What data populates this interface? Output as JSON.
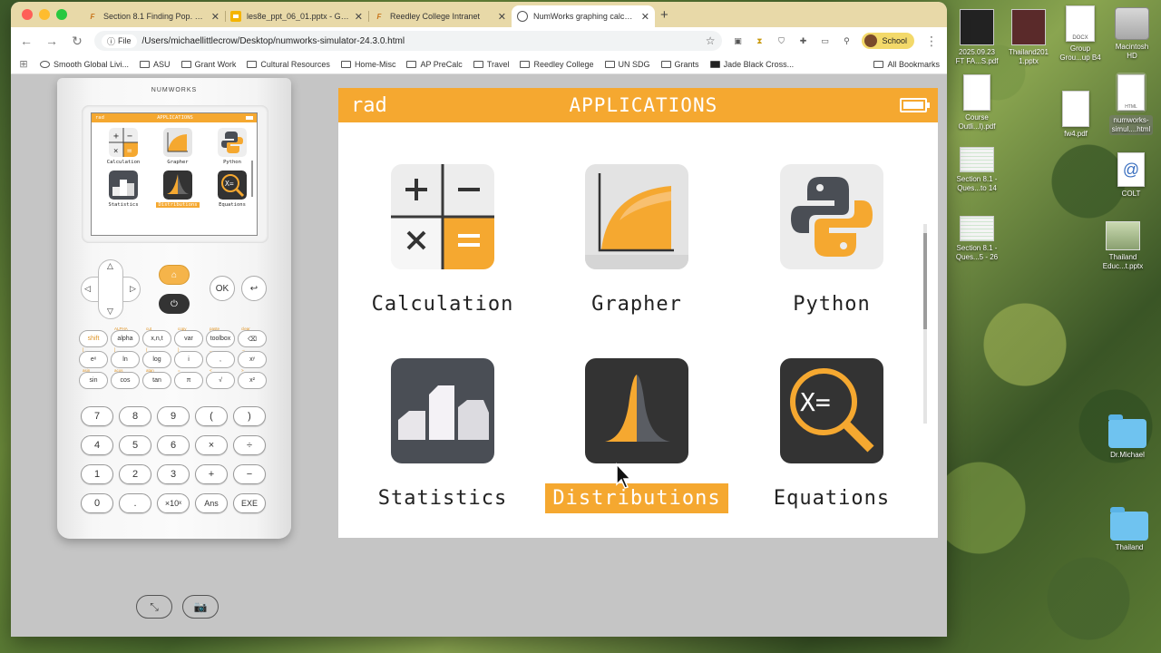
{
  "browser": {
    "tabs": [
      {
        "title": "Section 8.1 Finding Pop. Mean",
        "icon": "document-f-icon",
        "active": false
      },
      {
        "title": "les8e_ppt_06_01.pptx - Goo",
        "icon": "slides-icon",
        "active": false
      },
      {
        "title": "Reedley College Intranet",
        "icon": "document-f-icon",
        "active": false
      },
      {
        "title": "NumWorks graphing calculat",
        "icon": "numworks-icon",
        "active": true
      }
    ],
    "new_tab": "+",
    "address": {
      "chip": "File",
      "url": "/Users/michaellittlecrow/Desktop/numworks-simulator-24.3.0.html"
    },
    "profile": "School",
    "bookmarks": [
      "Smooth Global Livi...",
      "ASU",
      "Grant Work",
      "Cultural Resources",
      "Home-Misc",
      "AP PreCalc",
      "Travel",
      "Reedley College",
      "UN SDG",
      "Grants",
      "Jade Black Cross..."
    ],
    "all_bookmarks": "All Bookmarks"
  },
  "calculator": {
    "brand": "NUMWORKS",
    "mini_screen": {
      "mode": "rad",
      "title": "APPLICATIONS"
    },
    "fn_keys": [
      {
        "label": "shift",
        "alt": ""
      },
      {
        "label": "alpha",
        "alt": "ALPHA"
      },
      {
        "label": "x,n,t",
        "alt": "cut"
      },
      {
        "label": "var",
        "alt": "copy"
      },
      {
        "label": "toolbox",
        "alt": "paste"
      },
      {
        "label": "⌫",
        "alt": "clear"
      },
      {
        "label": "eˣ",
        "alt": "["
      },
      {
        "label": "ln",
        "alt": "]"
      },
      {
        "label": "log",
        "alt": "{"
      },
      {
        "label": "i",
        "alt": "}"
      },
      {
        "label": ",",
        "alt": "_"
      },
      {
        "label": "xʸ",
        "alt": "→"
      },
      {
        "label": "sin",
        "alt": "asin"
      },
      {
        "label": "cos",
        "alt": "acos"
      },
      {
        "label": "tan",
        "alt": "atan"
      },
      {
        "label": "π",
        "alt": "="
      },
      {
        "label": "√",
        "alt": "<"
      },
      {
        "label": "x²",
        "alt": ">"
      }
    ],
    "num_keys": [
      "7",
      "8",
      "9",
      "(",
      ")",
      "4",
      "5",
      "6",
      "×",
      "÷",
      "1",
      "2",
      "3",
      "+",
      "−",
      "0",
      ".",
      "×10ˣ",
      "Ans",
      "EXE"
    ],
    "ok": "OK"
  },
  "screen": {
    "mode": "rad",
    "title": "APPLICATIONS",
    "apps": [
      {
        "label": "Calculation",
        "selected": false
      },
      {
        "label": "Grapher",
        "selected": false
      },
      {
        "label": "Python",
        "selected": false
      },
      {
        "label": "Statistics",
        "selected": false
      },
      {
        "label": "Distributions",
        "selected": true
      },
      {
        "label": "Equations",
        "selected": false
      }
    ]
  },
  "desktop": {
    "icons": [
      {
        "label": "2025.09.23\nFT FA...S.pdf",
        "kind": "thumb"
      },
      {
        "label": "Thailand201\n1.pptx",
        "kind": "thumb"
      },
      {
        "label": "Group\nGrou...up B4",
        "kind": "docx"
      },
      {
        "label": "Macintosh\nHD",
        "kind": "disk"
      },
      {
        "label": "Course\nOutli...l).pdf",
        "kind": "doc"
      },
      {
        "label": "fw4.pdf",
        "kind": "doc"
      },
      {
        "label": "numworks-\nsimul....html",
        "kind": "html"
      },
      {
        "label": "Section 8.1 -\nQues...to 14",
        "kind": "sheet"
      },
      {
        "label": "COLT",
        "kind": "http"
      },
      {
        "label": "Section 8.1 -\nQues...5 - 26",
        "kind": "sheet"
      },
      {
        "label": "Thailand\nEduc...t.pptx",
        "kind": "photo"
      },
      {
        "label": "Dr.Michael",
        "kind": "folder"
      },
      {
        "label": "Thailand",
        "kind": "folder"
      }
    ]
  },
  "colors": {
    "accent": "#f5a830",
    "tab_strip": "#e8d9a8"
  }
}
